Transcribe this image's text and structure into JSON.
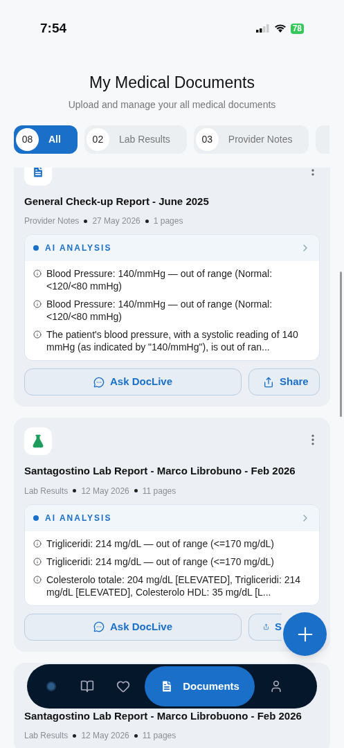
{
  "status_bar": {
    "time": "7:54",
    "battery": "78"
  },
  "header": {
    "title": "My Medical Documents",
    "subtitle": "Upload and manage your all medical documents"
  },
  "tabs": [
    {
      "count": "08",
      "label": "All",
      "selected": true
    },
    {
      "count": "02",
      "label": "Lab Results",
      "selected": false
    },
    {
      "count": "03",
      "label": "Provider Notes",
      "selected": false
    }
  ],
  "documents": [
    {
      "kind": "note",
      "title": "General Check-up Report - June 2025",
      "category": "Provider Notes",
      "date": "27 May 2026",
      "pages": "1 pages",
      "analysis": {
        "label": "AI ANALYSIS",
        "items": [
          "Blood Pressure: 140/mmHg — out of range (Normal: <120/<80 mmHg)",
          "Blood Pressure: 140/mmHg — out of range (Normal: <120/<80 mmHg)",
          "The patient's blood pressure, with a systolic reading of 140 mmHg (as indicated by \"140/mmHg\"), is out of ran..."
        ]
      },
      "actions": [
        "Ask DocLive",
        "Share"
      ]
    },
    {
      "kind": "lab",
      "title": "Santagostino Lab Report - Marco Librobuno - Feb 2026",
      "category": "Lab Results",
      "date": "12 May 2026",
      "pages": "11 pages",
      "analysis": {
        "label": "AI ANALYSIS",
        "items": [
          "Trigliceridi: 214 mg/dL — out of range (<=170 mg/dL)",
          "Trigliceridi: 214 mg/dL — out of range (<=170 mg/dL)",
          "Colesterolo totale: 204 mg/dL [ELEVATED], Trigliceridi: 214 mg/dL [ELEVATED], Colesterolo HDL: 35 mg/dL [L..."
        ]
      },
      "actions": [
        "Ask DocLive",
        "S"
      ]
    },
    {
      "title": "Santagostino Lab Report - Marco Librobuono - Feb 2026",
      "category": "Lab Results",
      "date": "12 May 2026",
      "pages": "11 pages"
    }
  ],
  "bottom_nav": [
    {
      "kind": "home",
      "selected": false
    },
    {
      "kind": "book",
      "selected": false
    },
    {
      "kind": "heart",
      "selected": false
    },
    {
      "kind": "documents",
      "label": "Documents",
      "selected": true
    },
    {
      "kind": "profile",
      "selected": false
    }
  ]
}
